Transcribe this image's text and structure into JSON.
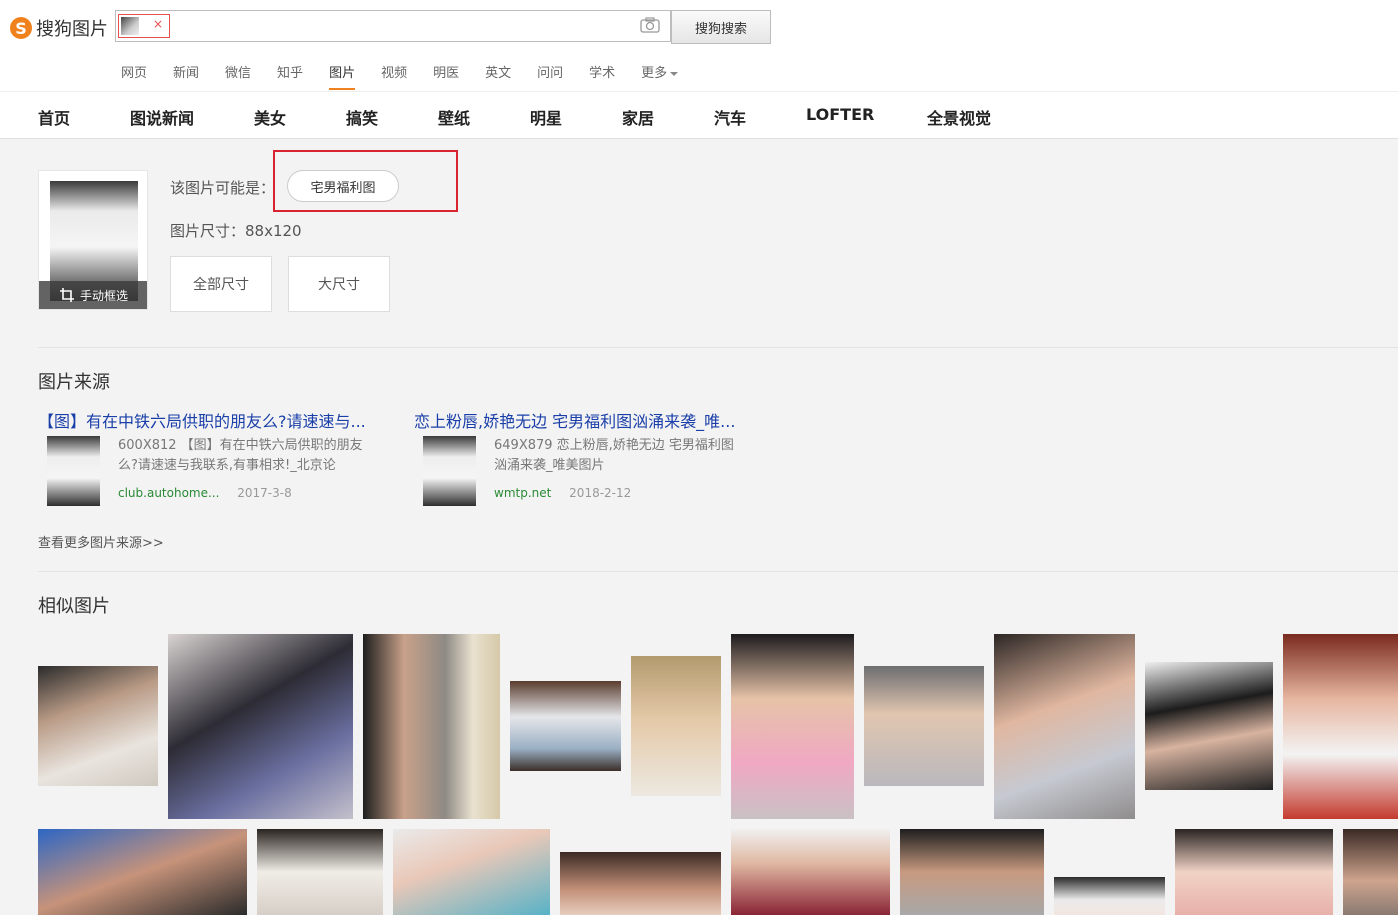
{
  "header": {
    "logo_text": "搜狗图片",
    "search_button": "搜狗搜索",
    "chip_close": "×",
    "vertical_tabs": [
      "网页",
      "新闻",
      "微信",
      "知乎",
      "图片",
      "视频",
      "明医",
      "英文",
      "问问",
      "学术",
      "更多"
    ],
    "active_tab": "图片"
  },
  "categories": [
    "首页",
    "图说新闻",
    "美女",
    "搞笑",
    "壁纸",
    "明星",
    "家居",
    "汽车",
    "LOFTER",
    "全景视觉"
  ],
  "query": {
    "crop_label": "手动框选",
    "maybe_label": "该图片可能是：",
    "maybe_tag": "宅男福利图",
    "size_label": "图片尺寸：88x120",
    "size_buttons": [
      "全部尺寸",
      "大尺寸"
    ]
  },
  "sources": {
    "title": "图片来源",
    "items": [
      {
        "title": "【图】有在中铁六局供职的朋友么?请速速与...",
        "desc": "600X812 【图】有在中铁六局供职的朋友么?请速速与我联系,有事相求!_北京论",
        "domain": "club.autohome...",
        "date": "2017-3-8"
      },
      {
        "title": "恋上粉唇,娇艳无边 宅男福利图汹涌来袭_唯...",
        "desc": "649X879 恋上粉唇,娇艳无边 宅男福利图汹涌来袭_唯美图片",
        "domain": "wmtp.net",
        "date": "2018-2-12"
      }
    ],
    "more_link": "查看更多图片来源>>"
  },
  "similar": {
    "title": "相似图片"
  },
  "colors": {
    "accent": "#f0821e",
    "link": "#1a3fa9",
    "domain_green": "#2a8a36",
    "highlight_red": "#d9232e"
  }
}
